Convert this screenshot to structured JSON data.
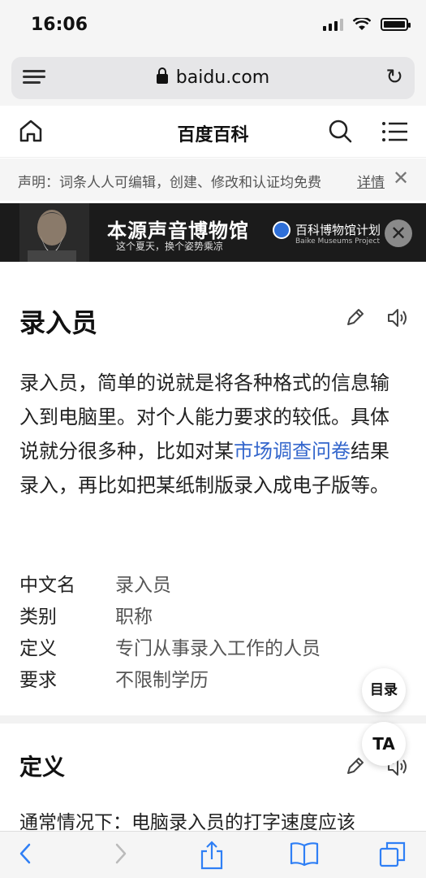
{
  "status": {
    "time": "16:06"
  },
  "browser": {
    "url": "baidu.com"
  },
  "header": {
    "title": "百度百科"
  },
  "notice": {
    "text": "声明：词条人人可编辑，创建、修改和认证均免费",
    "link": "详情"
  },
  "banner": {
    "title": "本源声音博物馆",
    "subtitle": "这个夏天，换个姿势乘凉",
    "brand": "百科博物馆计划",
    "brand_en": "Baike Museums Project"
  },
  "entry": {
    "title": "录入员",
    "summary_parts": {
      "p1": "录入员，简单的说就是将各种格式的信息输入到电脑里。对个人能力要求的较低。具体说就分很多种，比如对某",
      "link": "市场调查问卷",
      "p2": "结果录入，再比如把某纸制版录入成电子版等。"
    },
    "info": [
      {
        "label": "中文名",
        "value": "录入员"
      },
      {
        "label": "类别",
        "value": "职称"
      },
      {
        "label": "定义",
        "value": "专门从事录入工作的人员"
      },
      {
        "label": "要求",
        "value": "不限制学历"
      }
    ]
  },
  "floating": {
    "toc": "目录",
    "ta": "TA"
  },
  "section": {
    "title": "定义",
    "text": "通常情况下：电脑录入员的打字速度应该"
  },
  "toolbar": {
    "icons": [
      "back-icon",
      "forward-icon",
      "share-icon",
      "bookmarks-icon",
      "tabs-icon"
    ]
  },
  "colors": {
    "link": "#3366cc",
    "banner_bg": "#1b1b1b"
  }
}
